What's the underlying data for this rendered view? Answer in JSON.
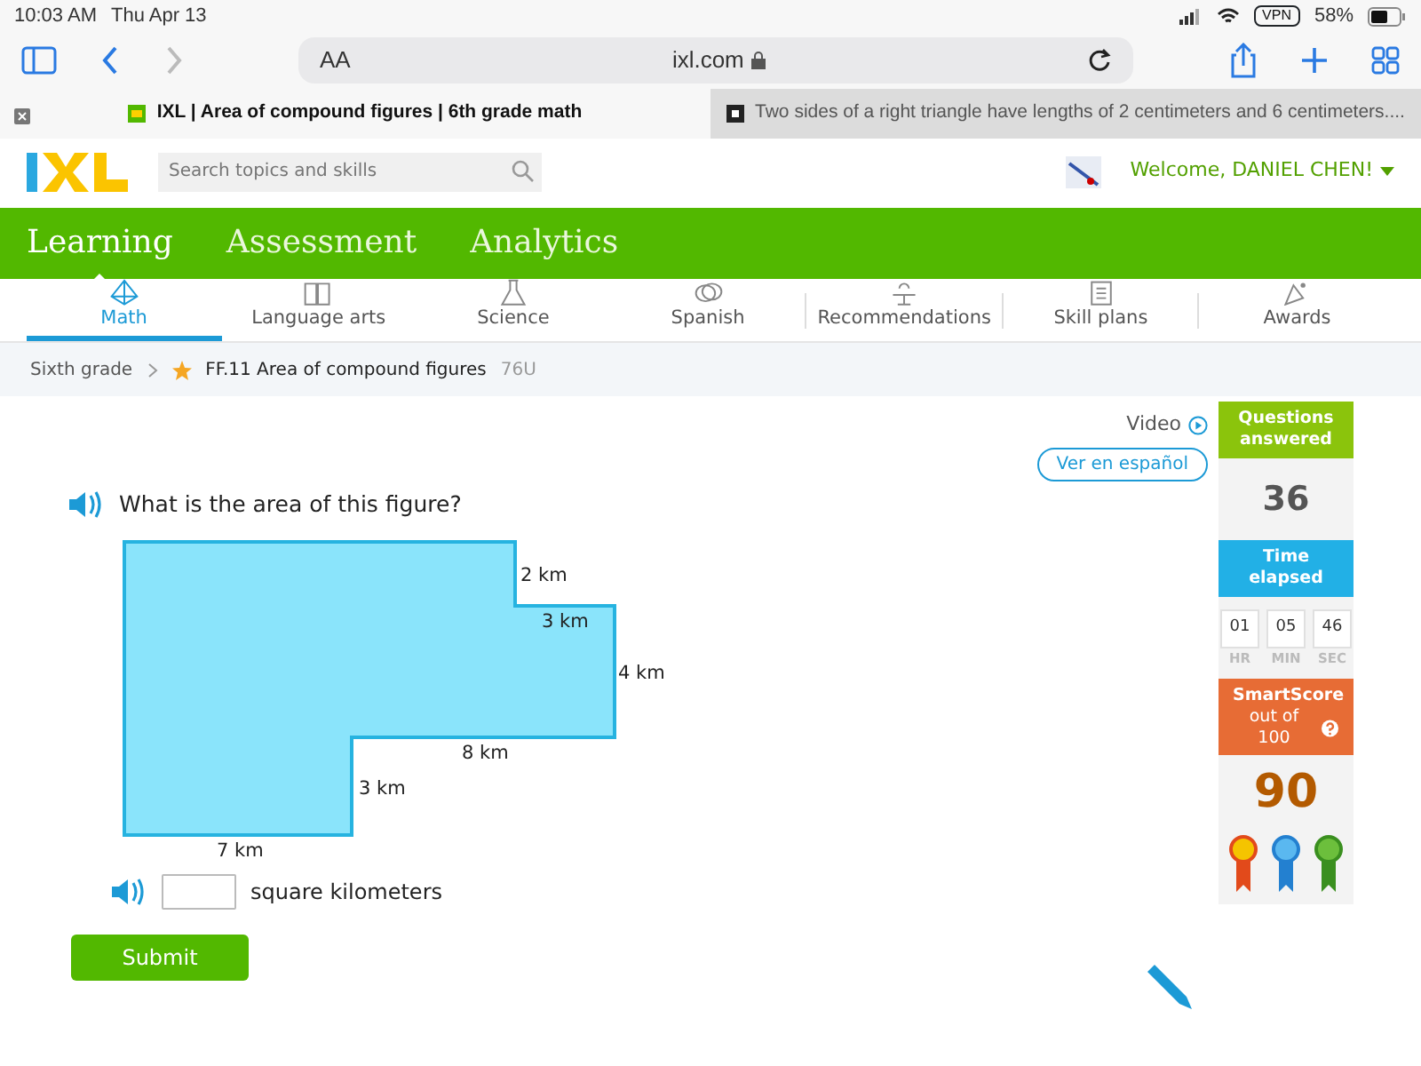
{
  "status_bar": {
    "time": "10:03 AM",
    "date": "Thu Apr 13",
    "vpn": "VPN",
    "battery": "58%"
  },
  "browser": {
    "text_size": "AA",
    "url": "ixl.com",
    "tabs": [
      {
        "title": "IXL | Area of compound figures | 6th grade math",
        "selected": true
      },
      {
        "title": "Two sides of a right triangle have lengths of 2 centimeters and 6 centimeters....",
        "selected": false
      }
    ]
  },
  "header": {
    "search": {
      "placeholder": "Search topics and skills"
    },
    "welcome": "Welcome, DANIEL CHEN!"
  },
  "main_nav": [
    {
      "label": "Learning",
      "selected": true
    },
    {
      "label": "Assessment",
      "selected": false
    },
    {
      "label": "Analytics",
      "selected": false
    }
  ],
  "subjects": [
    {
      "label": "Math",
      "selected": true
    },
    {
      "label": "Language arts",
      "selected": false
    },
    {
      "label": "Science",
      "selected": false
    },
    {
      "label": "Spanish",
      "selected": false
    },
    {
      "label": "Recommendations",
      "selected": false
    },
    {
      "label": "Skill plans",
      "selected": false
    },
    {
      "label": "Awards",
      "selected": false
    }
  ],
  "breadcrumb": {
    "grade": "Sixth grade",
    "skill": "FF.11 Area of compound figures",
    "code": "76U"
  },
  "question": {
    "video": "Video",
    "spanish": "Ver en español",
    "prompt": "What is the area of this figure?",
    "figure": {
      "labels": [
        "2 km",
        "3 km",
        "4 km",
        "8 km",
        "3 km",
        "7 km"
      ]
    },
    "answer": {
      "unit": "square kilometers"
    },
    "submit": "Submit"
  },
  "sidebar": {
    "answered_title": "Questions answered",
    "answered": "36",
    "time_title": "Time elapsed",
    "time": [
      {
        "value": "01",
        "unit": "HR"
      },
      {
        "value": "05",
        "unit": "MIN"
      },
      {
        "value": "46",
        "unit": "SEC"
      }
    ],
    "score_title": "SmartScore",
    "score_subtitle": "out of 100",
    "score": "90"
  }
}
